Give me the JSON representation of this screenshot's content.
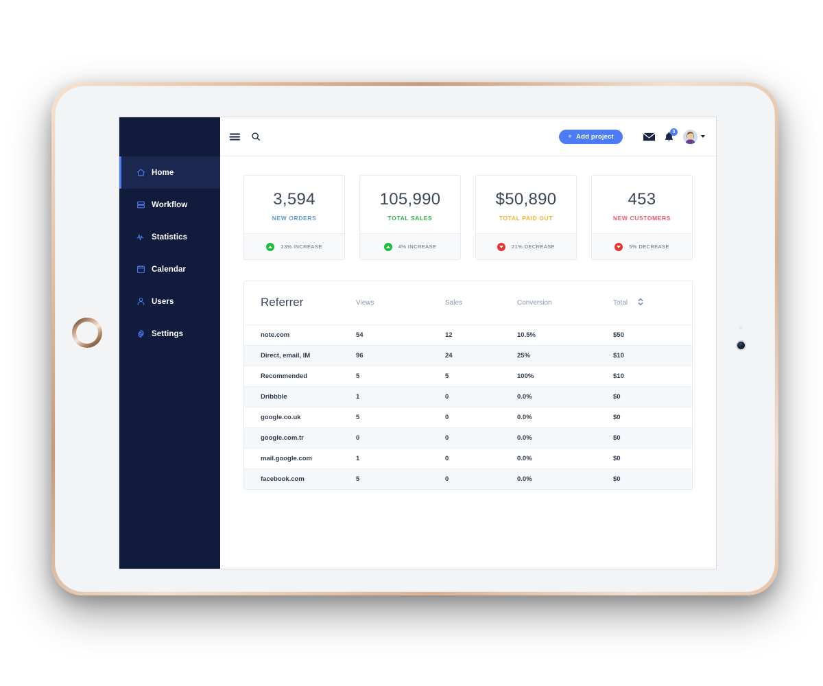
{
  "sidebar": {
    "items": [
      {
        "label": "Home",
        "icon": "home-icon",
        "active": true
      },
      {
        "label": "Workflow",
        "icon": "workflow-icon",
        "active": false
      },
      {
        "label": "Statistics",
        "icon": "statistics-icon",
        "active": false
      },
      {
        "label": "Calendar",
        "icon": "calendar-icon",
        "active": false
      },
      {
        "label": "Users",
        "icon": "users-icon",
        "active": false
      },
      {
        "label": "Settings",
        "icon": "settings-icon",
        "active": false
      }
    ],
    "background_color": "#111c3c",
    "active_accent": "#4c7cf5"
  },
  "topbar": {
    "menu_icon": "collapse-menu-icon",
    "search_icon": "search-icon",
    "add_project_label": "Add project",
    "add_project_plus": "+",
    "add_project_color": "#4c7cf5",
    "mail_icon": "mail-icon",
    "bell_icon": "bell-icon",
    "notification_count": "3",
    "avatar": "user-avatar",
    "caret_icon": "chevron-down-icon"
  },
  "stat_cards": [
    {
      "value": "3,594",
      "label": "NEW ORDERS",
      "label_color": "#5b9bd5",
      "trend": "13% INCREASE",
      "direction": "up"
    },
    {
      "value": "105,990",
      "label": "TOTAL SALES",
      "label_color": "#2db34a",
      "trend": "4% INCREASE",
      "direction": "up"
    },
    {
      "value": "$50,890",
      "label": "TOTAL PAID OUT",
      "label_color": "#f5b225",
      "trend": "21% DECREASE",
      "direction": "down"
    },
    {
      "value": "453",
      "label": "NEW CUSTOMERS",
      "label_color": "#f2566a",
      "trend": "5% DECREASE",
      "direction": "down"
    }
  ],
  "table": {
    "title": "Referrer",
    "columns": [
      "Views",
      "Sales",
      "Conversion",
      "Total"
    ],
    "sort_icon": "sort-updown-icon",
    "rows": [
      {
        "referrer": "note.com",
        "views": "54",
        "sales": "12",
        "conversion": "10.5%",
        "total": "$50"
      },
      {
        "referrer": "Direct, email, IM",
        "views": "96",
        "sales": "24",
        "conversion": "25%",
        "total": "$10"
      },
      {
        "referrer": "Recommended",
        "views": "5",
        "sales": "5",
        "conversion": "100%",
        "total": "$10"
      },
      {
        "referrer": "Dribbble",
        "views": "1",
        "sales": "0",
        "conversion": "0.0%",
        "total": "$0"
      },
      {
        "referrer": "google.co.uk",
        "views": "5",
        "sales": "0",
        "conversion": "0.0%",
        "total": "$0"
      },
      {
        "referrer": "google.com.tr",
        "views": "0",
        "sales": "0",
        "conversion": "0.0%",
        "total": "$0"
      },
      {
        "referrer": "mail.google.com",
        "views": "1",
        "sales": "0",
        "conversion": "0.0%",
        "total": "$0"
      },
      {
        "referrer": "facebook.com",
        "views": "5",
        "sales": "0",
        "conversion": "0.0%",
        "total": "$0"
      }
    ]
  },
  "device": {
    "home_button": "home-button",
    "camera": "front-camera",
    "sensor": "ambient-light-sensor"
  }
}
